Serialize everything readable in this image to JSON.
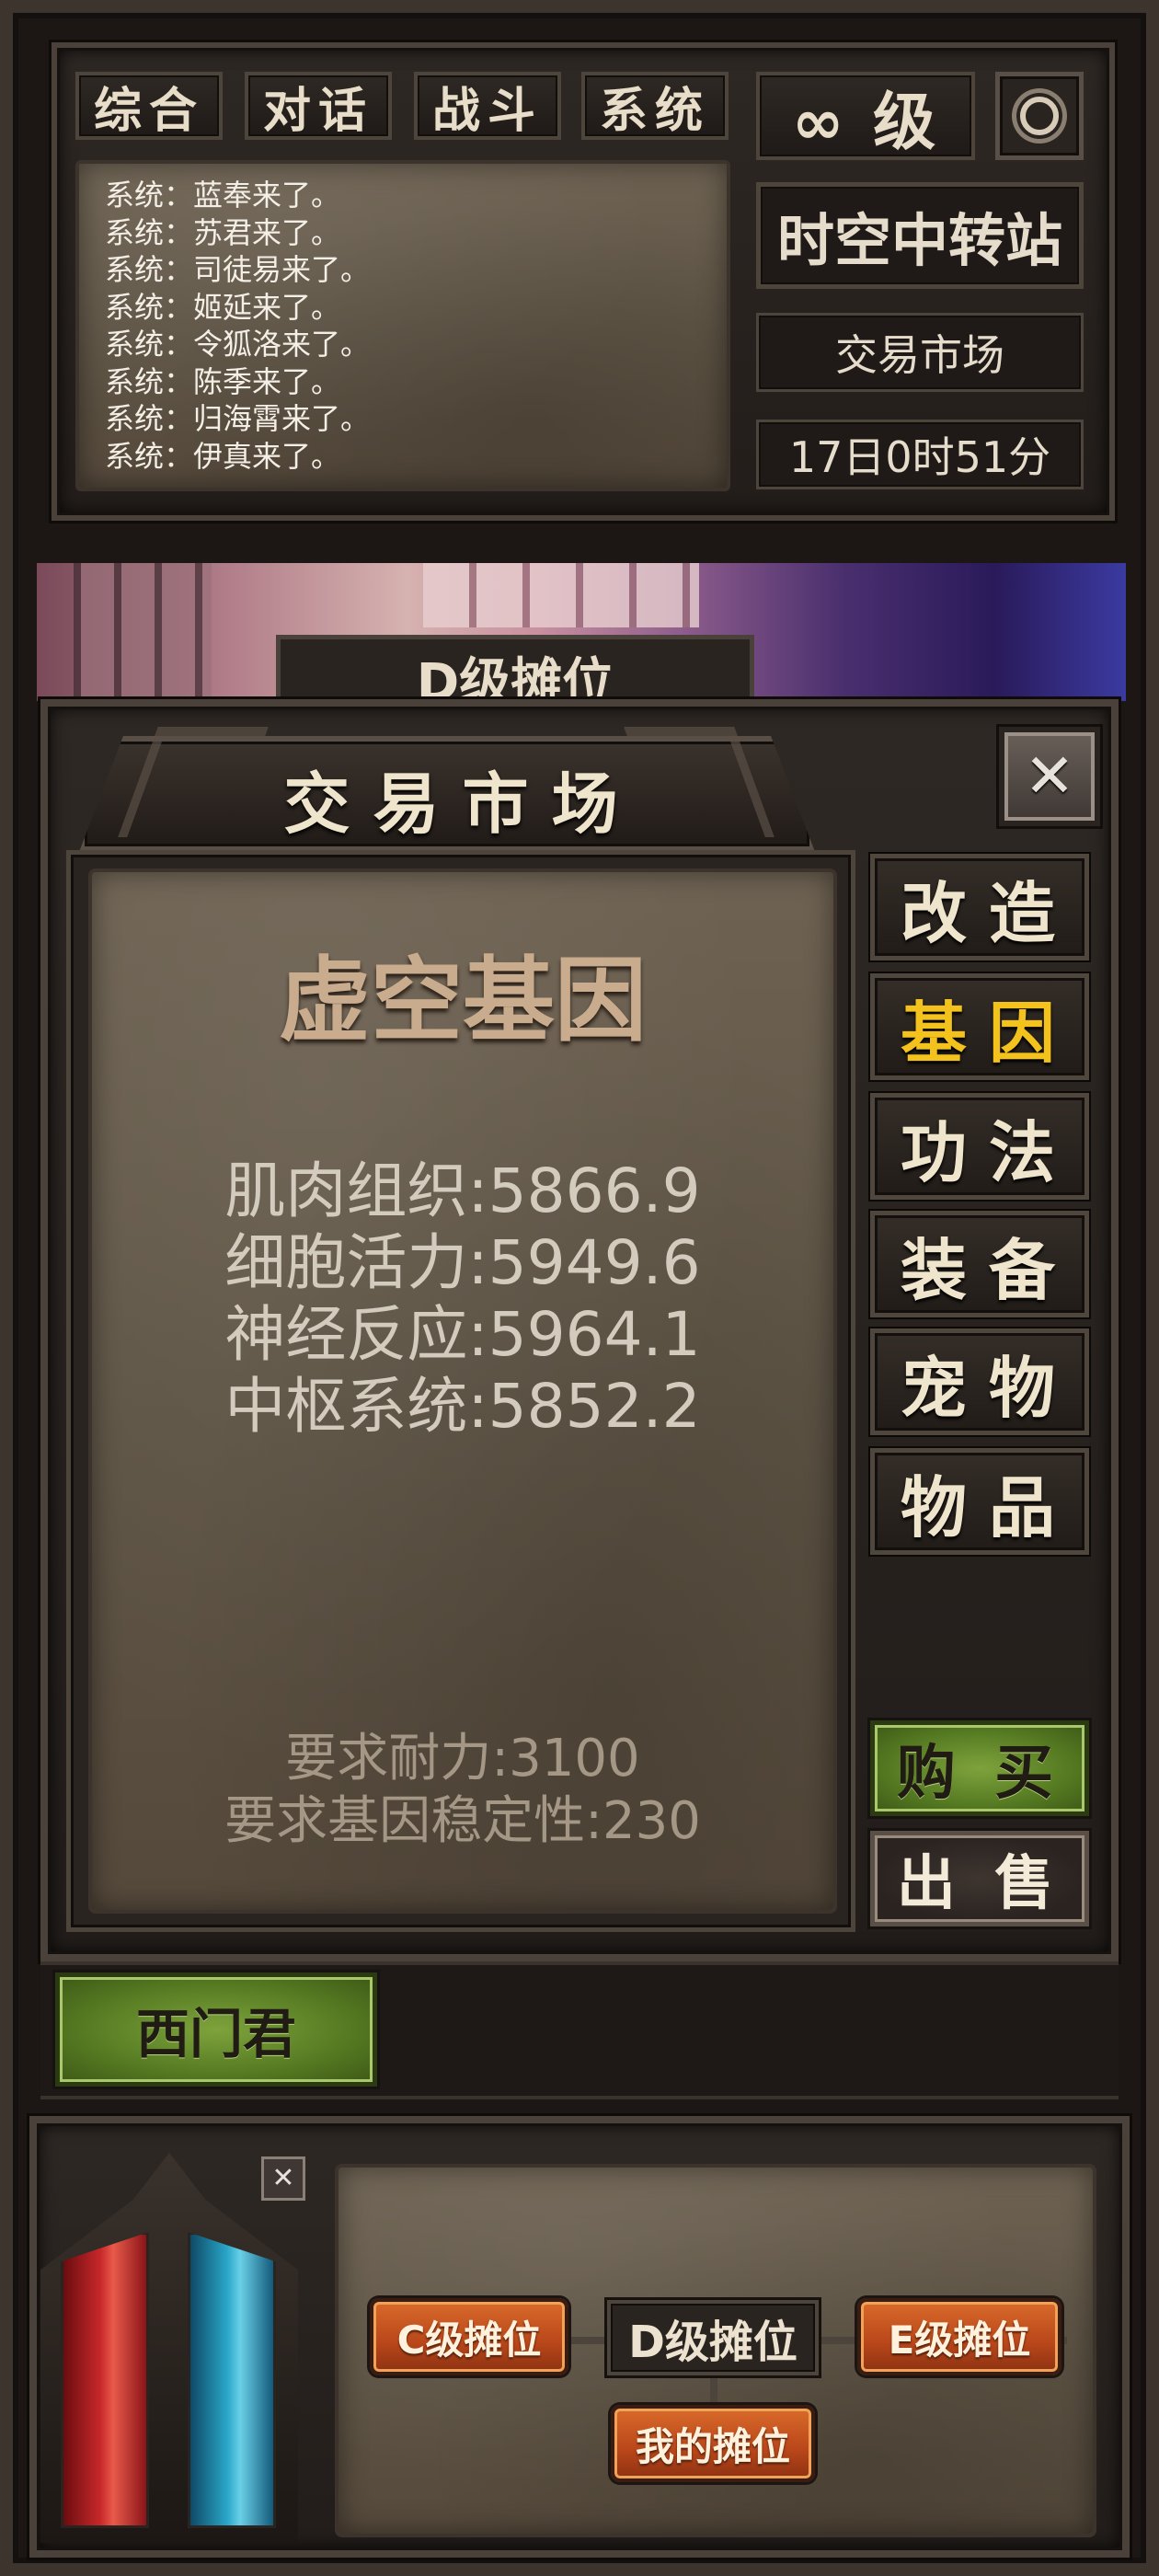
{
  "top_tabs": [
    "综合",
    "对话",
    "战斗",
    "系统"
  ],
  "level_label": "∞ 级",
  "location": "时空中转站",
  "sub_location": "交易市场",
  "game_time": "17日0时51分",
  "chat_lines": [
    "系统：蓝奉来了。",
    "系统：苏君来了。",
    "系统：司徒易来了。",
    "系统：姬延来了。",
    "系统：令狐洛来了。",
    "系统：陈季来了。",
    "系统：归海霄来了。",
    "系统：伊真来了。"
  ],
  "background_banner": "D级摊位",
  "market": {
    "title": "交 易 市 场",
    "close_label": "✕",
    "item": {
      "name": "虚空基因",
      "stats": [
        "肌肉组织:5866.9",
        "细胞活力:5949.6",
        "神经反应:5964.1",
        "中枢系统:5852.2"
      ],
      "requirements": [
        "要求耐力:3100",
        "要求基因稳定性:230"
      ]
    },
    "categories": [
      "改造",
      "基因",
      "功法",
      "装备",
      "宠物",
      "物品"
    ],
    "active_category": "基因",
    "buy_label": "购 买",
    "sell_label": "出 售"
  },
  "seller": "西门君",
  "stalls": {
    "c": "C级摊位",
    "d": "D级摊位",
    "e": "E级摊位",
    "mine": "我的摊位"
  },
  "colors": {
    "active_tab": "#f3c21d",
    "hp": "#c9282a",
    "mp": "#2aa7c9",
    "buy": "#6a9130",
    "stall": "#c5541f"
  }
}
